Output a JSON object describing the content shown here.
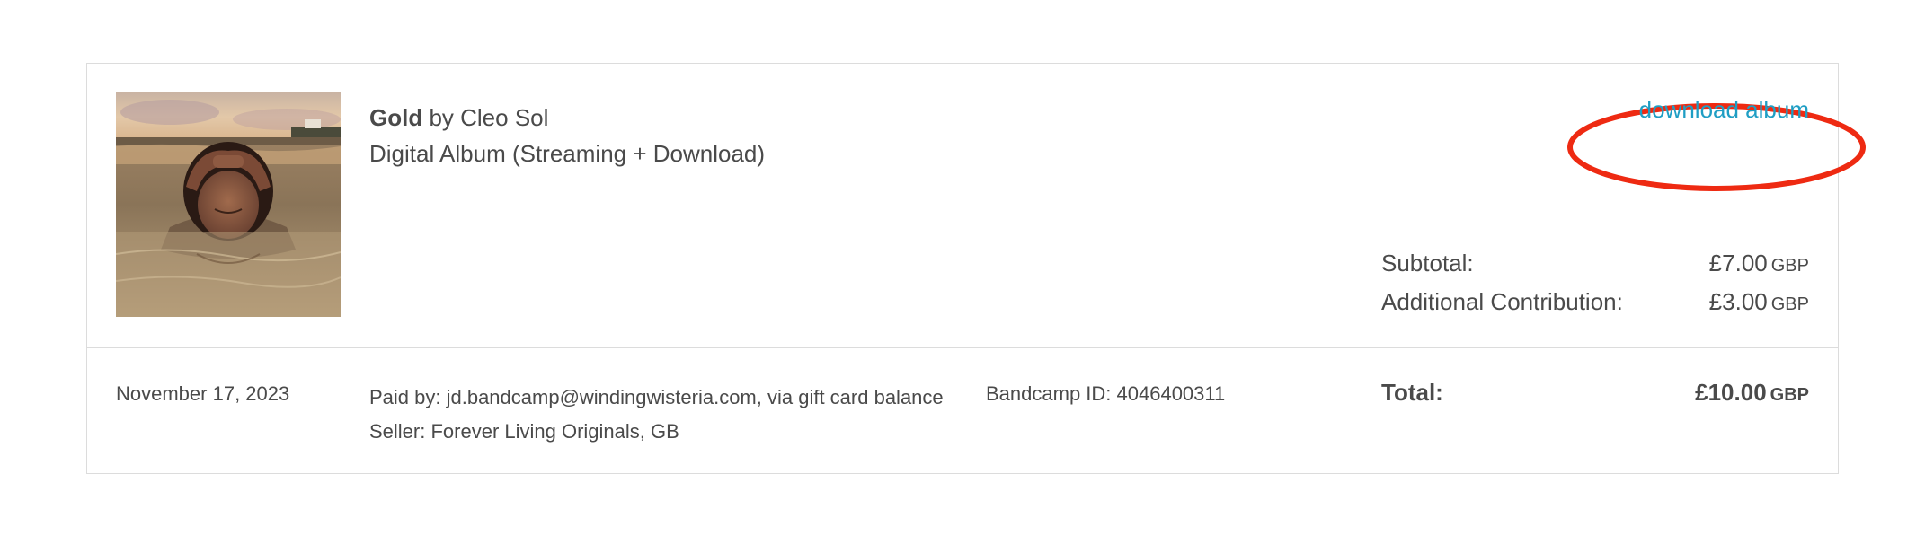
{
  "item": {
    "title": "Gold",
    "by_text": " by Cleo Sol",
    "format": "Digital Album (Streaming + Download)"
  },
  "actions": {
    "download_label": "download album"
  },
  "totals": {
    "subtotal_label": "Subtotal:",
    "subtotal_amount": "£7.00",
    "subtotal_currency": "GBP",
    "contribution_label": "Additional Contribution:",
    "contribution_amount": "£3.00",
    "contribution_currency": "GBP",
    "total_label": "Total:",
    "total_amount": "£10.00",
    "total_currency": "GBP"
  },
  "payment": {
    "date": "November 17, 2023",
    "paid_by": "Paid by: jd.bandcamp@windingwisteria.com, via gift card balance",
    "seller": "Seller: Forever Living Originals, GB",
    "bandcamp_id": "Bandcamp ID: 4046400311"
  },
  "colors": {
    "link": "#1f9ec4",
    "annotation": "#ee2a12",
    "border": "#dcdcdc",
    "text": "#4a4a4a"
  },
  "icons": {
    "cover": "album-cover-image"
  }
}
